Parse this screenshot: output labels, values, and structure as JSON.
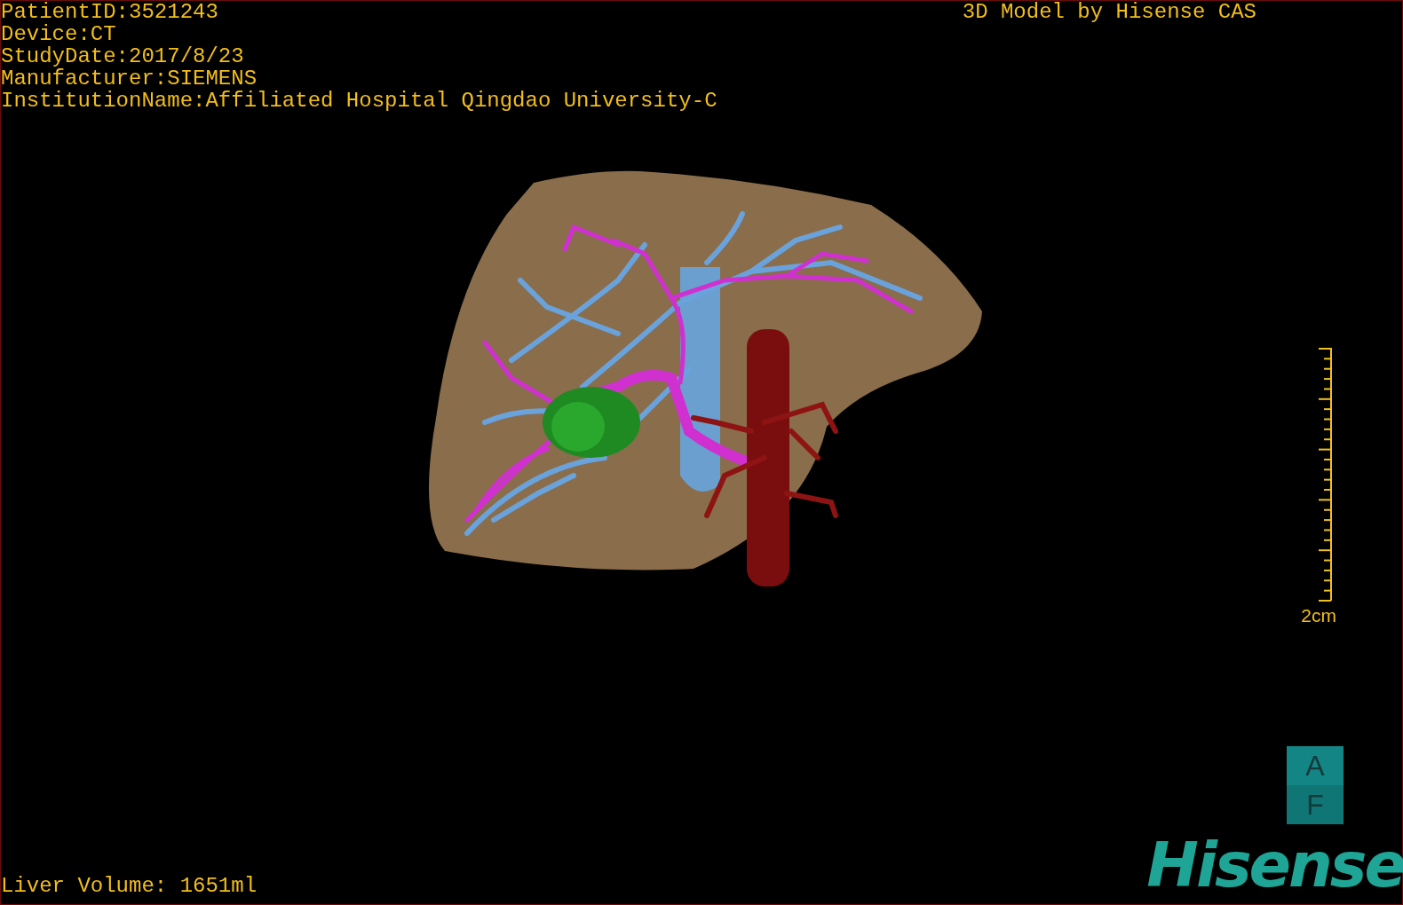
{
  "info_lines": [
    "PatientID:3521243",
    "Device:CT",
    "StudyDate:2017/8/23",
    "Manufacturer:SIEMENS",
    "InstitutionName:Affiliated Hospital Qingdao University-C"
  ],
  "credit": "3D Model by Hisense CAS",
  "scale_bar": {
    "label": "2cm"
  },
  "orientation_marker": {
    "top": "A",
    "bottom": "F"
  },
  "liver_volume": "Liver Volume: 1651ml",
  "logo": "Hisense"
}
